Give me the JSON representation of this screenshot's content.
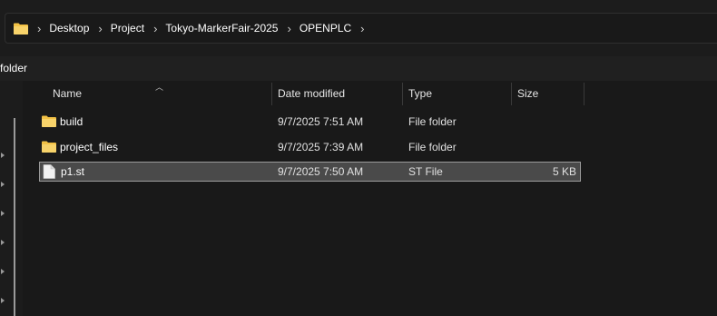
{
  "address_bar": {
    "crumbs": [
      "Desktop",
      "Project",
      "Tokyo-MarkerFair-2025",
      "OPENPLC"
    ],
    "separator": "›"
  },
  "toolbar": {
    "partial_text": "folder"
  },
  "columns": {
    "name": "Name",
    "date_modified": "Date modified",
    "type": "Type",
    "size": "Size"
  },
  "files": [
    {
      "name": "build",
      "date": "9/7/2025 7:51 AM",
      "type": "File folder",
      "size": "",
      "icon": "folder-icon"
    },
    {
      "name": "project_files",
      "date": "9/7/2025 7:39 AM",
      "type": "File folder",
      "size": "",
      "icon": "folder-icon"
    },
    {
      "name": "p1.st",
      "date": "9/7/2025 7:50 AM",
      "type": "ST File",
      "size": "5 KB",
      "icon": "file-icon",
      "selected": true
    }
  ],
  "colors": {
    "folder": "#f3c246",
    "selection": "#4a4a4a",
    "background": "#191919"
  }
}
